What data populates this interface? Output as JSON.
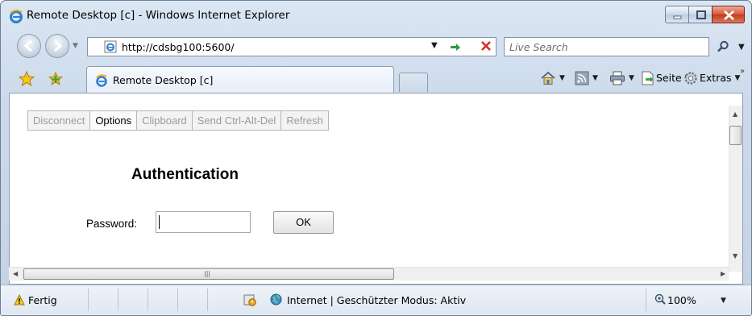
{
  "window": {
    "title": "Remote Desktop [c] - Windows Internet Explorer"
  },
  "nav": {
    "url": "http://cdsbg100:5600/",
    "search_placeholder": "Live Search"
  },
  "tabs": [
    {
      "label": "Remote Desktop [c]"
    }
  ],
  "command_bar": {
    "page_label": "Seite",
    "tools_label": "Extras",
    "overflow_label": "»"
  },
  "vnc_toolbar": [
    {
      "label": "Disconnect",
      "enabled": false
    },
    {
      "label": "Options",
      "enabled": true
    },
    {
      "label": "Clipboard",
      "enabled": false
    },
    {
      "label": "Send Ctrl-Alt-Del",
      "enabled": false
    },
    {
      "label": "Refresh",
      "enabled": false
    }
  ],
  "auth": {
    "title": "Authentication",
    "password_label": "Password:",
    "password_value": "",
    "ok_label": "OK"
  },
  "status": {
    "text": "Fertig",
    "zone": "Internet | Geschützter Modus: Aktiv",
    "zoom": "100%"
  },
  "colors": {
    "frame": "#c3d3e6",
    "close_button": "#c13a18",
    "disabled_text": "#9a9a9a"
  },
  "icons": {
    "title": "ie-logo-icon",
    "back": "back-arrow-icon",
    "forward": "forward-arrow-icon",
    "refresh": "refresh-icon",
    "stop": "stop-icon",
    "search": "magnifier-icon",
    "favorites": "favorites-star-icon",
    "add_favorite": "add-favorite-icon",
    "home": "home-icon",
    "feeds": "feeds-icon",
    "print": "print-icon",
    "page": "page-icon",
    "tools": "gear-icon",
    "status": "warning-icon",
    "zone": "globe-icon",
    "zoom": "zoom-icon"
  }
}
